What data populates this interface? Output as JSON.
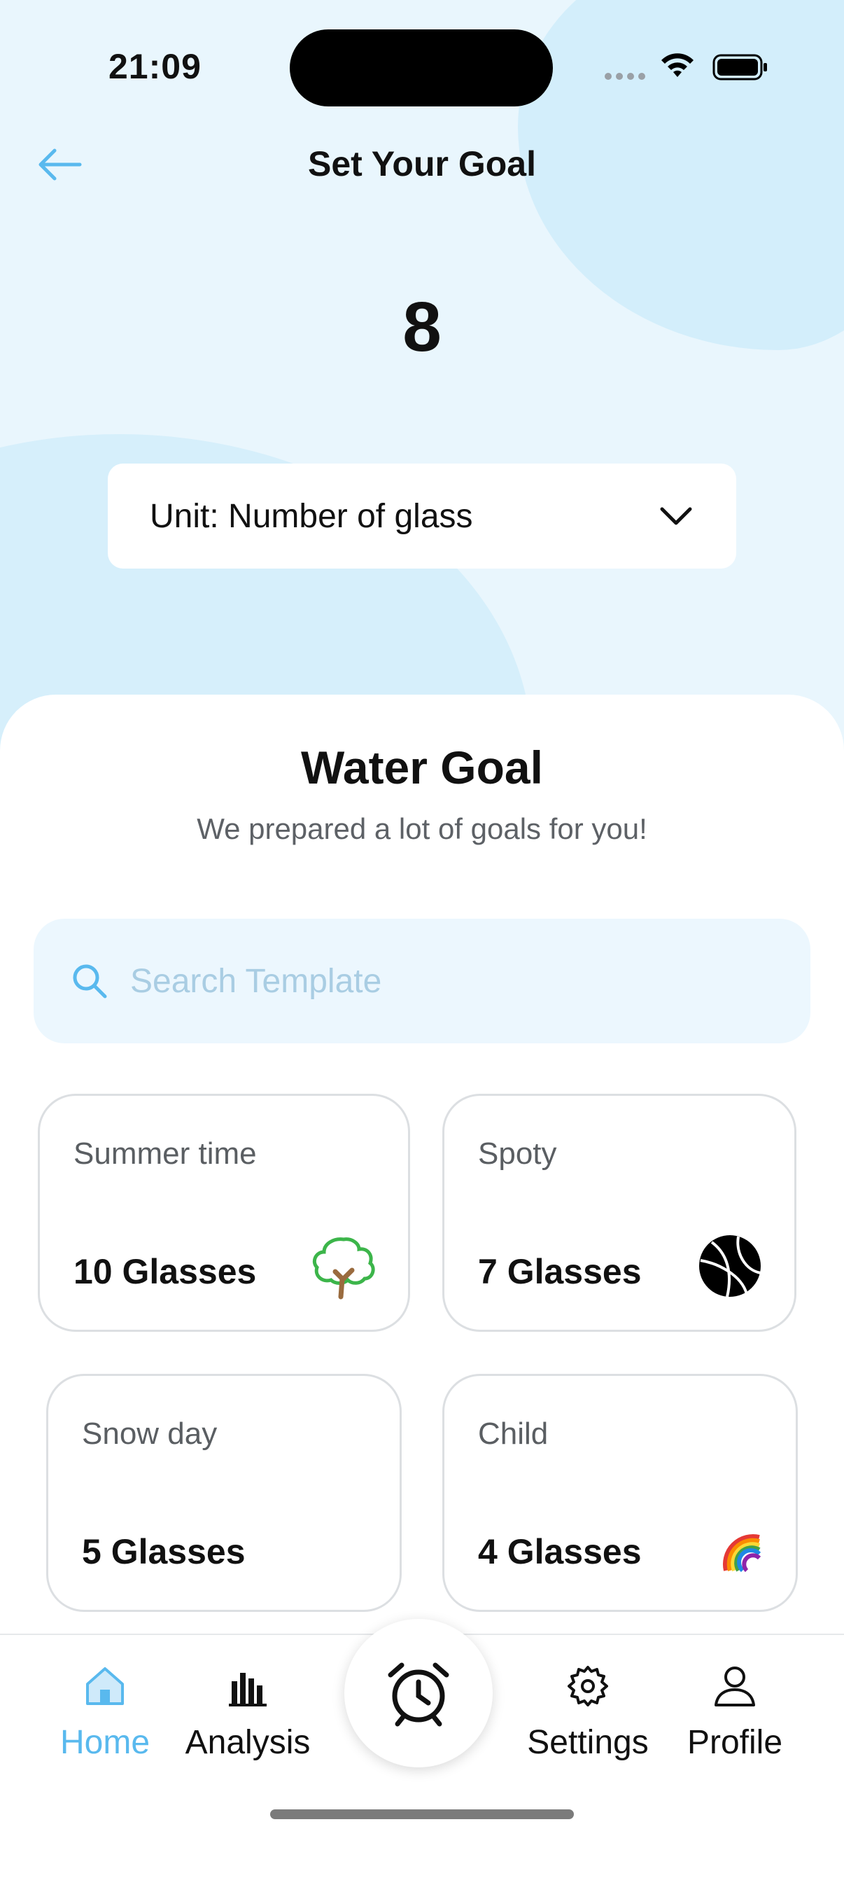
{
  "status_bar": {
    "time": "21:09"
  },
  "header": {
    "title": "Set Your Goal"
  },
  "goal": {
    "value": "8"
  },
  "unit_select": {
    "label": "Unit: Number of glass"
  },
  "sheet": {
    "title": "Water Goal",
    "subtitle": "We prepared a lot of goals for you!"
  },
  "search": {
    "placeholder": "Search Template"
  },
  "templates": [
    {
      "name": "Summer time",
      "amount": "10 Glasses",
      "icon": "tree-icon"
    },
    {
      "name": "Spoty",
      "amount": "7 Glasses",
      "icon": "basketball-icon"
    },
    {
      "name": "Snow day",
      "amount": "5 Glasses",
      "icon": "none"
    },
    {
      "name": "Child",
      "amount": "4 Glasses",
      "icon": "rainbow-icon"
    }
  ],
  "nav": {
    "items": [
      {
        "label": "Home",
        "icon": "home-icon",
        "active": true
      },
      {
        "label": "Analysis",
        "icon": "bar-chart-icon",
        "active": false
      },
      {
        "label": "Settings",
        "icon": "gear-icon",
        "active": false
      },
      {
        "label": "Profile",
        "icon": "person-icon",
        "active": false
      }
    ],
    "center_button_icon": "alarm-clock-icon"
  },
  "colors": {
    "accent": "#59b9ee",
    "background": "#e9f6fd",
    "search_bg": "#ecf7fe"
  }
}
